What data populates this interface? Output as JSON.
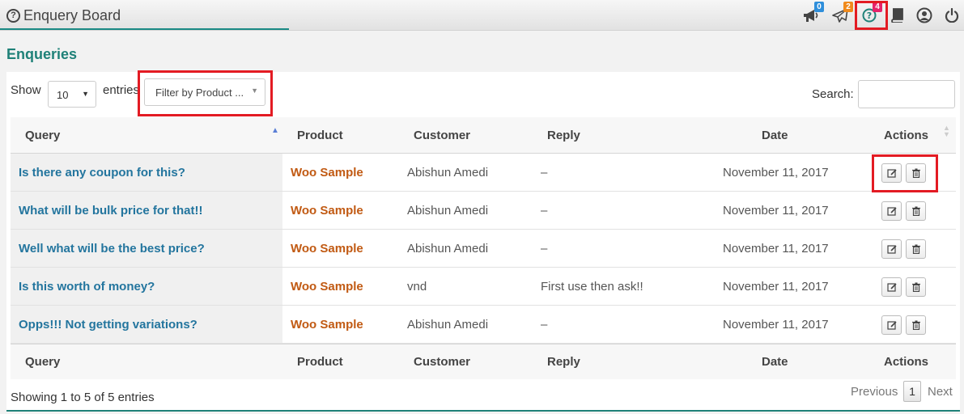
{
  "header": {
    "title": "Enquery Board",
    "badges": {
      "announcements": "0",
      "messages": "2",
      "enquiries": "4"
    }
  },
  "section_title": "Enqueries",
  "controls": {
    "show_label": "Show",
    "page_length": "10",
    "entries_label": "entries",
    "filter_placeholder": "Filter by Product ...",
    "search_label": "Search:"
  },
  "table": {
    "columns": [
      "Query",
      "Product",
      "Customer",
      "Reply",
      "Date",
      "Actions"
    ],
    "rows": [
      {
        "query": "Is there any coupon for this?",
        "product": "Woo Sample",
        "customer": "Abishun Amedi",
        "reply": "–",
        "date": "November 11, 2017"
      },
      {
        "query": "What will be bulk price for that!!",
        "product": "Woo Sample",
        "customer": "Abishun Amedi",
        "reply": "–",
        "date": "November 11, 2017"
      },
      {
        "query": "Well what will be the best price?",
        "product": "Woo Sample",
        "customer": "Abishun Amedi",
        "reply": "–",
        "date": "November 11, 2017"
      },
      {
        "query": "Is this worth of money?",
        "product": "Woo Sample",
        "customer": "vnd",
        "reply": "First use then ask!!",
        "date": "November 11, 2017"
      },
      {
        "query": "Opps!!! Not getting variations?",
        "product": "Woo Sample",
        "customer": "Abishun Amedi",
        "reply": "–",
        "date": "November 11, 2017"
      }
    ]
  },
  "footer": {
    "info": "Showing 1 to 5 of 5 entries",
    "previous": "Previous",
    "current_page": "1",
    "next": "Next"
  },
  "colors": {
    "accent": "#1f8178",
    "query_link": "#23759e",
    "product_link": "#c15a13",
    "highlight": "#e31b23"
  }
}
